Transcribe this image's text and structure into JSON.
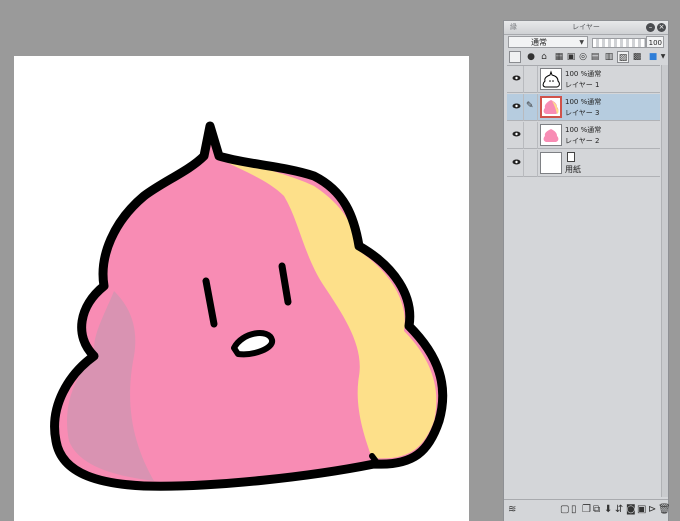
{
  "layer_panel": {
    "title_left": "縁",
    "title": "レイヤー",
    "blend_mode": "通常",
    "opacity": "100",
    "layers": [
      {
        "opacity_mode": "100 %通常",
        "name": "レイヤー 1"
      },
      {
        "opacity_mode": "100 %通常",
        "name": "レイヤー 3"
      },
      {
        "opacity_mode": "100 %通常",
        "name": "レイヤー 2"
      },
      {
        "name": "用紙"
      }
    ]
  },
  "icons": {
    "minimize": "minimize-icon",
    "close": "close-icon",
    "eye": "eye-icon",
    "pen": "pen-icon",
    "paper": "paper-icon",
    "layer_stack": "layer-stack-icon",
    "new_layer": "new-layer-icon",
    "trash": "trash-icon"
  },
  "colors": {
    "selected_row": "#b6ccdf",
    "pink": "#f88cb4",
    "mauve": "#d993b2",
    "yellow": "#fde08a"
  }
}
